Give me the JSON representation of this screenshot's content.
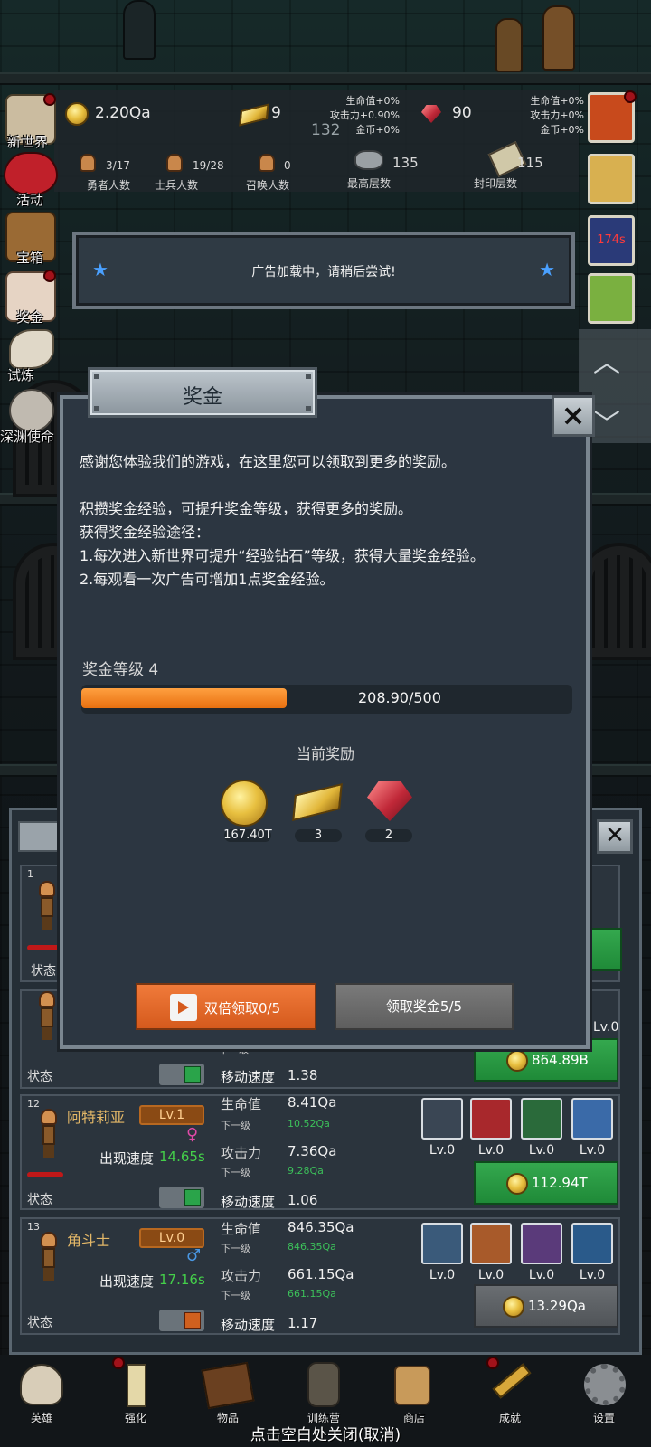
{
  "resources": {
    "coins": "2.20Qa",
    "gold_bars": "9",
    "gems": "90",
    "mid_number": "132",
    "bonus_left": [
      "生命值+0%",
      "攻击力+0.90%",
      "金币+0%"
    ],
    "bonus_right": [
      "生命值+0%",
      "攻击力+0%",
      "金币+0%"
    ],
    "hero_count_value": "3/17",
    "hero_count_label": "勇者人数",
    "soldier_count_value": "19/28",
    "soldier_count_label": "士兵人数",
    "summon_count_value": "0",
    "summon_count_label": "召唤人数",
    "max_floor_value": "135",
    "max_floor_label": "最高层数",
    "sealed_floor_value": "115",
    "sealed_floor_label": "封印层数"
  },
  "side_menu": [
    "新世界",
    "活动",
    "宝箱",
    "奖金",
    "试炼",
    "深渊使命"
  ],
  "right_menu": {
    "timer": "174s"
  },
  "ad_notice": "广告加载中，请稍后尝试!",
  "dialog": {
    "title": "奖金",
    "close_label": "×",
    "lines": [
      "感谢您体验我们的游戏，在这里您可以领取到更多的奖励。",
      "",
      "积攒奖金经验，可提升奖金等级，获得更多的奖励。",
      "获得奖金经验途径：",
      "1.每次进入新世界可提升“经验钻石”等级，获得大量奖金经验。",
      "2.每观看一次广告可增加1点奖金经验。"
    ],
    "level_label": "奖金等级 4",
    "progress_text": "208.90/500",
    "progress_fraction": 0.4178,
    "reward_title": "当前奖励",
    "rewards": [
      {
        "icon": "coin-icon",
        "amount": "167.40T"
      },
      {
        "icon": "gold-bar-icon",
        "amount": "3"
      },
      {
        "icon": "gem-icon",
        "amount": "2"
      }
    ],
    "double_button": "双倍领取0/5",
    "claim_button": "领取奖金5/5"
  },
  "heroes": [
    {
      "index": "1",
      "status_label": "状态"
    },
    {
      "status_label": "状态",
      "move_speed_label": "移动速度",
      "move_speed": "1.38",
      "next_label": "下一级",
      "buy_price": "864.89B",
      "skill_level": "Lv.0"
    },
    {
      "index": "12",
      "name": "阿特莉亚",
      "level": "Lv.1",
      "gender": "♀",
      "spawn_label": "出现速度",
      "spawn_speed": "14.65s",
      "hp_label": "生命值",
      "hp": "8.41Qa",
      "hp_next_label": "下一级",
      "hp_next": "10.52Qa",
      "atk_label": "攻击力",
      "atk": "7.36Qa",
      "atk_next_label": "下一级",
      "atk_next": "9.28Qa",
      "move_speed_label": "移动速度",
      "move_speed": "1.06",
      "status_label": "状态",
      "skills": [
        "Lv.0",
        "Lv.0",
        "Lv.0",
        "Lv.0"
      ],
      "buy_price": "112.94T"
    },
    {
      "index": "13",
      "name": "角斗士",
      "level": "Lv.0",
      "gender": "♂",
      "spawn_label": "出现速度",
      "spawn_speed": "17.16s",
      "hp_label": "生命值",
      "hp": "846.35Qa",
      "hp_next_label": "下一级",
      "hp_next": "846.35Qa",
      "atk_label": "攻击力",
      "atk": "661.15Qa",
      "atk_next_label": "下一级",
      "atk_next": "661.15Qa",
      "move_speed_label": "移动速度",
      "move_speed": "1.17",
      "status_label": "状态",
      "skills": [
        "Lv.0",
        "Lv.0",
        "Lv.0",
        "Lv.0"
      ],
      "buy_price": "13.29Qa"
    }
  ],
  "bottom_nav": [
    "英雄",
    "强化",
    "物品",
    "训练营",
    "商店",
    "成就",
    "设置"
  ],
  "close_hint": "点击空白处关闭(取消)",
  "colors": {
    "accent_orange": "#e87010",
    "buy_green": "#1f8a38",
    "dialog_bg": "#2c3641",
    "gold_text": "#e4b868"
  }
}
